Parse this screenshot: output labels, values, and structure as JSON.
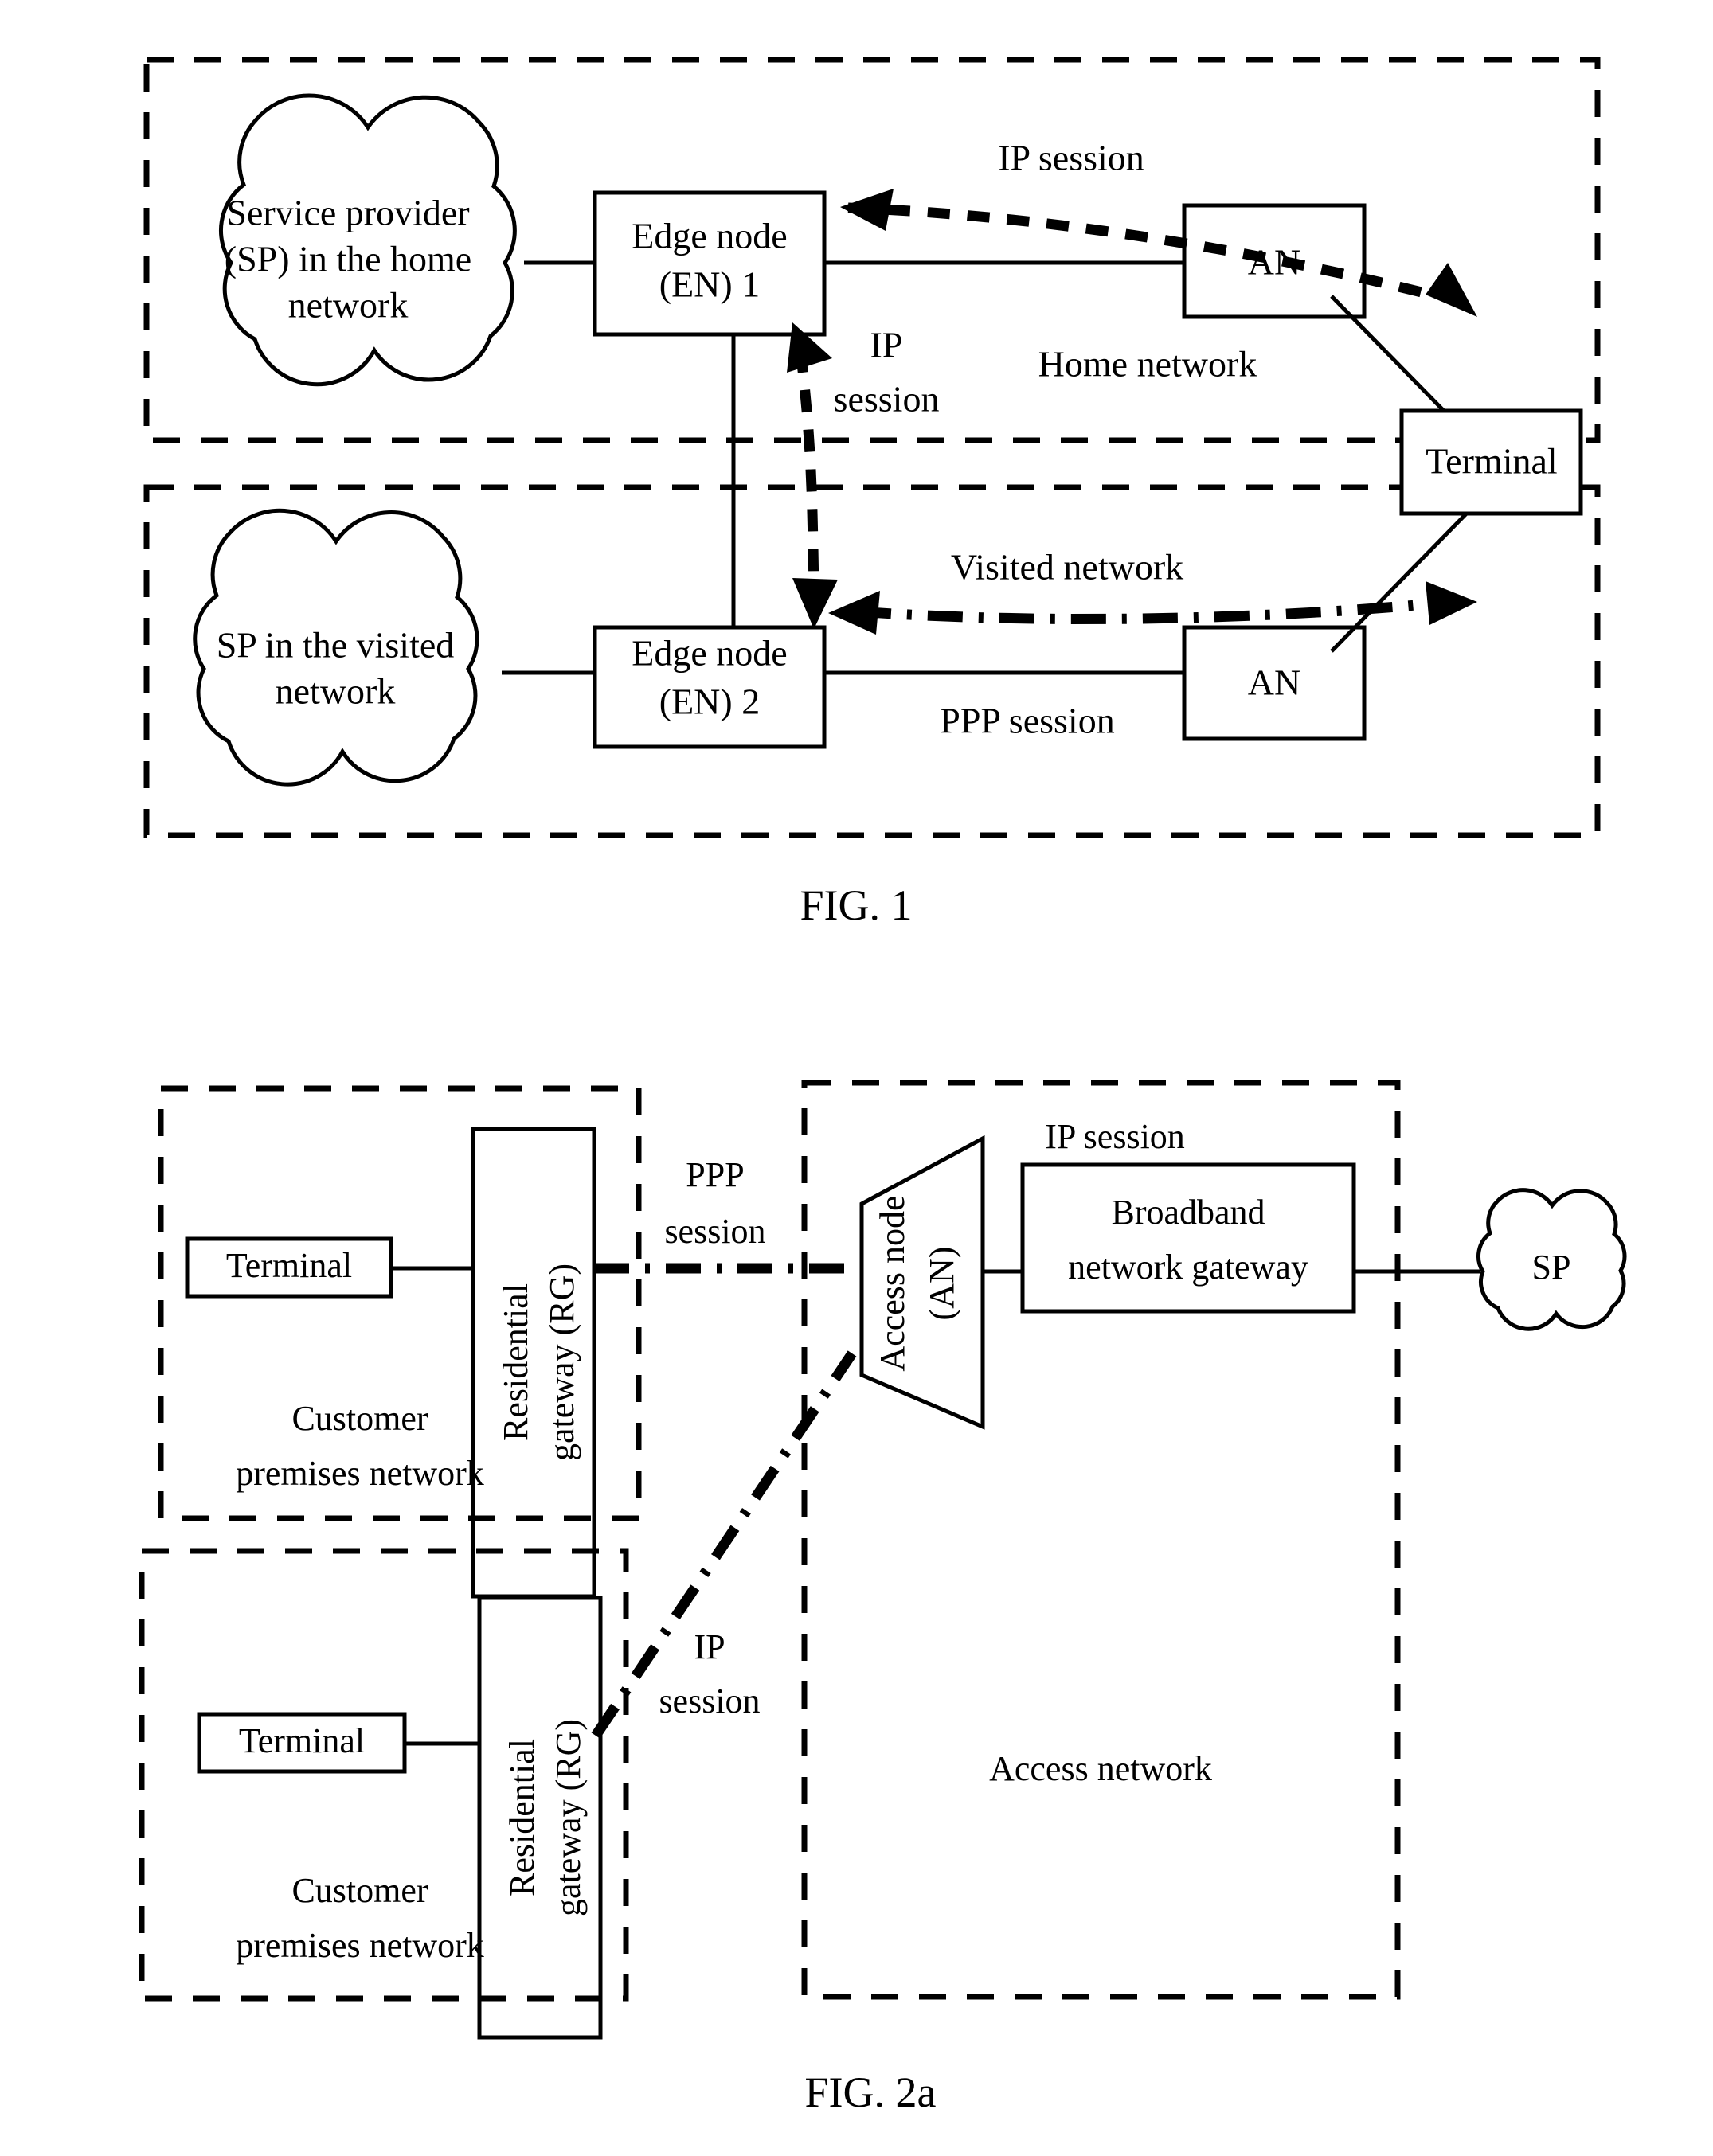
{
  "figure1": {
    "caption": "FIG. 1",
    "home_network": {
      "area_label": "Home network",
      "sp_cloud": "Service provider (SP) in the home network",
      "sp_cloud_lines": [
        "Service provider",
        "(SP) in the home",
        "network"
      ],
      "edge_node": "Edge node (EN) 1",
      "edge_node_lines": [
        "Edge node",
        "(EN) 1"
      ],
      "access_node": "AN",
      "session_label": "IP session"
    },
    "visited_network": {
      "area_label": "Visited network",
      "sp_cloud": "SP in the visited network",
      "sp_cloud_lines": [
        "SP in the visited",
        "network"
      ],
      "edge_node": "Edge node (EN) 2",
      "edge_node_lines": [
        "Edge node",
        "(EN) 2"
      ],
      "access_node": "AN",
      "session_label": "PPP session"
    },
    "inter_en_session": "IP session",
    "inter_en_session_lines": [
      "IP",
      "session"
    ],
    "terminal": "Terminal"
  },
  "figure2a": {
    "caption": "FIG. 2a",
    "cpn_top": {
      "area_label": "Customer premises network",
      "area_label_lines": [
        "Customer",
        "premises network"
      ],
      "terminal": "Terminal",
      "gateway": "Residential gateway (RG)",
      "gateway_lines": [
        "Residential",
        "gateway (RG)"
      ]
    },
    "cpn_bottom": {
      "area_label": "Customer premises network",
      "area_label_lines": [
        "Customer",
        "premises network"
      ],
      "terminal": "Terminal",
      "gateway": "Residential gateway (RG)",
      "gateway_lines": [
        "Residential",
        "gateway (RG)"
      ]
    },
    "access_network": {
      "area_label": "Access network",
      "access_node": "Access node (AN)",
      "access_node_lines": [
        "Access node",
        "(AN)"
      ],
      "bng": "Broadband network gateway",
      "bng_lines": [
        "Broadband",
        "network gateway"
      ],
      "ip_session_label": "IP session"
    },
    "ppp_session_label": "PPP session",
    "ppp_session_lines": [
      "PPP",
      "session"
    ],
    "ip_session_label": "IP session",
    "ip_session_lines": [
      "IP",
      "session"
    ],
    "sp_cloud": "SP"
  },
  "colors": {
    "ink": "#000000",
    "paper": "#ffffff"
  }
}
